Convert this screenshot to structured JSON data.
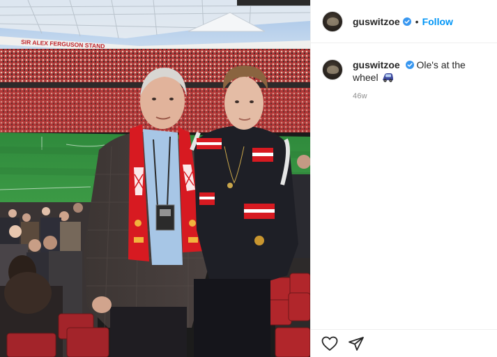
{
  "post": {
    "username": "guswitzoe",
    "follow_label": "Follow",
    "separator": "•",
    "caption_text": "Ole's at the wheel",
    "timestamp": "46w",
    "photo": {
      "stadium_sign": "SIR ALEX FERGUSON STAND"
    }
  },
  "icons": {
    "verified": "verified-badge-icon",
    "like": "heart-icon",
    "share": "paper-plane-icon",
    "caption_emoji": "car-emoji-icon"
  },
  "colors": {
    "link_blue": "#0095f6",
    "verified_blue": "#3897f0",
    "text": "#262626",
    "muted": "#8e8e8e",
    "united_red": "#d71a21"
  }
}
